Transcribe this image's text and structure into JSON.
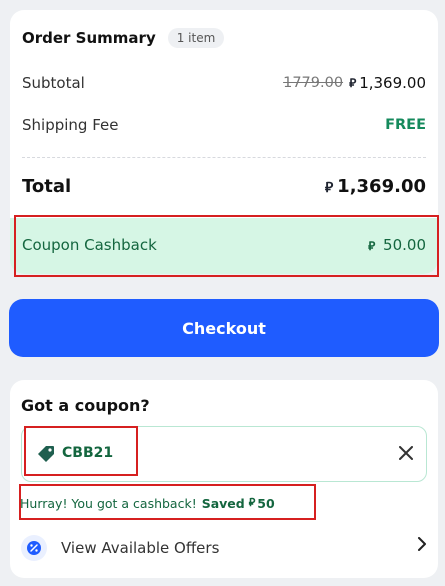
{
  "summary": {
    "title": "Order Summary",
    "item_count": "1 item",
    "subtotal_label": "Subtotal",
    "subtotal_original": "1779.00",
    "subtotal_value": "1,369.00",
    "shipping_label": "Shipping Fee",
    "shipping_value": "FREE",
    "total_label": "Total",
    "total_value": "1,369.00",
    "cashback_label": "Coupon Cashback",
    "cashback_value": "50.00",
    "currency_icon": "riyal-icon"
  },
  "checkout": {
    "label": "Checkout"
  },
  "coupon": {
    "title": "Got a coupon?",
    "code": "CBB21",
    "success_text": "Hurray! You got a cashback!",
    "saved_label": "Saved",
    "saved_value": "50",
    "offers_label": "View Available Offers"
  },
  "colors": {
    "accent": "#1f5cff",
    "success": "#158a5c",
    "cashback_bg": "#d6f6e5",
    "highlight": "#d62020"
  }
}
